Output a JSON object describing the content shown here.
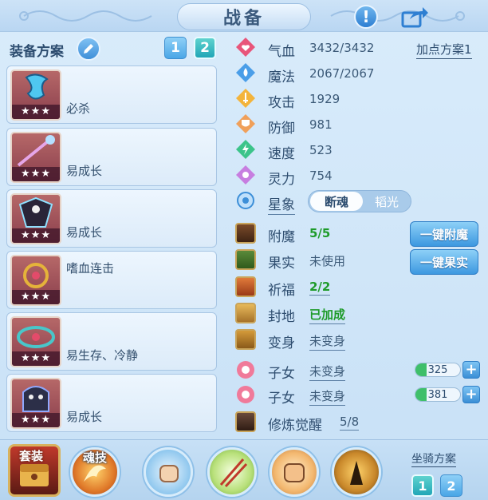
{
  "window": {
    "title": "战备"
  },
  "equip_scheme": {
    "title": "装备方案",
    "tabs": [
      "1",
      "2"
    ],
    "items": [
      {
        "name": "必杀",
        "stars": "★★★"
      },
      {
        "name": "易成长",
        "stars": "★★★"
      },
      {
        "name": "易成长",
        "stars": "★★★"
      },
      {
        "name": "嗜血连击",
        "stars": "★★★"
      },
      {
        "name": "易生存、冷静",
        "stars": "★★★"
      },
      {
        "name": "易成长",
        "stars": "★★★"
      }
    ]
  },
  "attributes": {
    "add_point_scheme": "加点方案1",
    "stats": [
      {
        "label": "气血",
        "value": "3432/3432",
        "icon": "heart-icon",
        "color": "#e8557a"
      },
      {
        "label": "魔法",
        "value": "2067/2067",
        "icon": "magic-drop-icon",
        "color": "#4a9ee8"
      },
      {
        "label": "攻击",
        "value": "1929",
        "icon": "sword-icon",
        "color": "#f3b43c"
      },
      {
        "label": "防御",
        "value": "981",
        "icon": "shield-icon",
        "color": "#f0a05a"
      },
      {
        "label": "速度",
        "value": "523",
        "icon": "lightning-icon",
        "color": "#3cc48a"
      },
      {
        "label": "灵力",
        "value": "754",
        "icon": "sparkle-icon",
        "color": "#c77ee0"
      }
    ],
    "star_image": {
      "label": "星象",
      "options": [
        "断魂",
        "韬光"
      ],
      "selected": "断魂"
    }
  },
  "enhancements": [
    {
      "label": "附魔",
      "value": "5/5",
      "style": "green",
      "underline": false,
      "icon": "enchant-icon"
    },
    {
      "label": "果实",
      "value": "未使用",
      "style": "plain",
      "underline": false,
      "icon": "fruit-icon"
    },
    {
      "label": "祈福",
      "value": "2/2",
      "style": "green",
      "underline": true,
      "icon": "blessing-icon"
    },
    {
      "label": "封地",
      "value": "已加成",
      "style": "green",
      "underline": true,
      "icon": "fief-icon"
    },
    {
      "label": "变身",
      "value": "未变身",
      "style": "plain",
      "underline": true,
      "icon": "transform-icon"
    },
    {
      "label": "子女",
      "value": "未变身",
      "style": "plain",
      "underline": true,
      "icon": "child-icon"
    },
    {
      "label": "子女",
      "value": "未变身",
      "style": "plain",
      "underline": true,
      "icon": "child-icon"
    },
    {
      "label": "修炼觉醒",
      "value": "5/8",
      "style": "plain",
      "underline": true,
      "icon": "cultivation-icon"
    }
  ],
  "buttons": {
    "enchant_all": "一键附魔",
    "fruit_all": "一键果实"
  },
  "child_steppers": [
    {
      "value": "325"
    },
    {
      "value": "381"
    }
  ],
  "bottom": {
    "suit_label": "套装",
    "soul_skill_label": "魂技",
    "mount_scheme": "坐骑方案",
    "mount_tabs": [
      "1",
      "2"
    ]
  }
}
